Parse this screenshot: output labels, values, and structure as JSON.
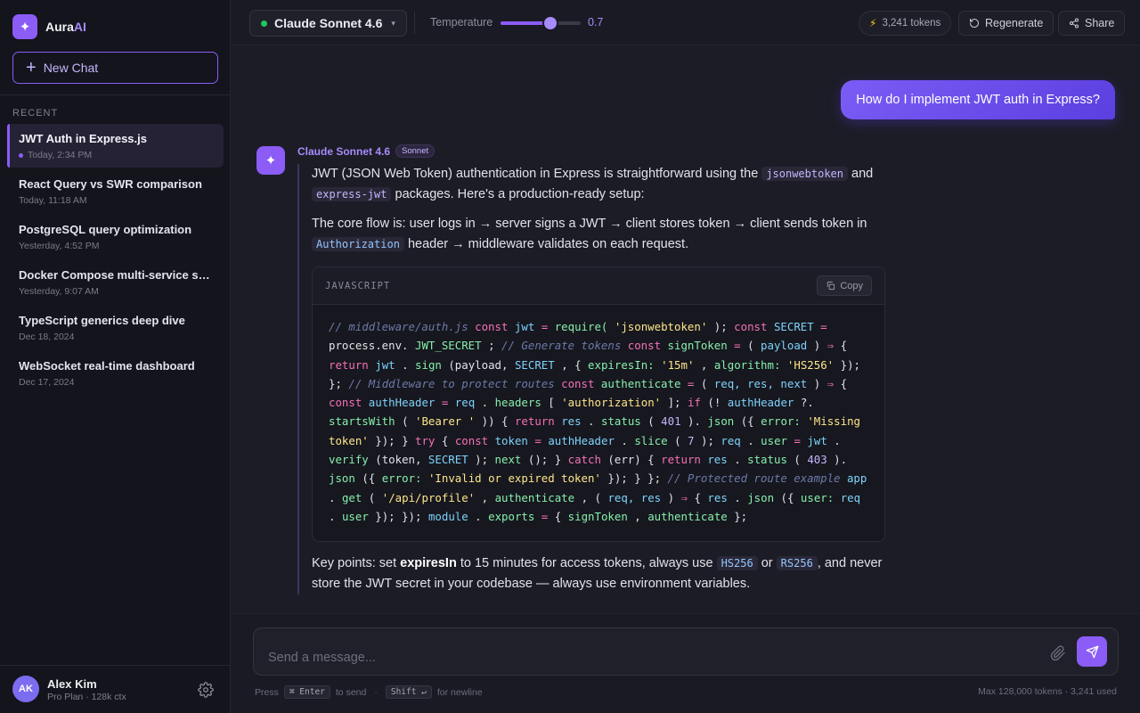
{
  "brand": {
    "name_main": "Aura",
    "name_accent": "AI",
    "logo_icon": "sparkle-icon"
  },
  "sidebar": {
    "new_chat_label": "New Chat",
    "recent_label": "RECENT",
    "items": [
      {
        "title": "JWT Auth in Express.js",
        "time": "Today, 2:34 PM",
        "active": true
      },
      {
        "title": "React Query vs SWR comparison",
        "time": "Today, 11:18 AM"
      },
      {
        "title": "PostgreSQL query optimization",
        "time": "Yesterday, 4:52 PM"
      },
      {
        "title": "Docker Compose multi-service set...",
        "time": "Yesterday, 9:07 AM"
      },
      {
        "title": "TypeScript generics deep dive",
        "time": "Dec 18, 2024"
      },
      {
        "title": "WebSocket real-time dashboard",
        "time": "Dec 17, 2024"
      }
    ],
    "user": {
      "initials": "AK",
      "name": "Alex Kim",
      "plan": "Pro Plan · 128k ctx"
    }
  },
  "topbar": {
    "model": "Claude Sonnet 4.6",
    "model_status_color": "#22c55e",
    "temperature_label": "Temperature",
    "temperature_value": "0.7",
    "temperature_fraction": 0.62,
    "tokens_label": "3,241 tokens",
    "regenerate_label": "Regenerate",
    "share_label": "Share"
  },
  "chat": {
    "user_message": "How do I implement JWT auth in Express?",
    "assistant": {
      "name": "Claude Sonnet 4.6",
      "badge": "Sonnet",
      "p1_a": "JWT (JSON Web Token) authentication in Express is straightforward using the",
      "p1_code1": "jsonwebtoken",
      "p1_b": "and",
      "p1_code2": "express-jwt",
      "p1_c": "packages. Here's a production-ready setup:",
      "p2_a": "The core flow is: user logs in → server signs a JWT → client stores token → client sends token in",
      "p2_code": "Authorization",
      "p2_b": "header → middleware validates on each request.",
      "code_lang": "JAVASCRIPT",
      "copy_label": "Copy",
      "p3_a": "Key points: set",
      "p3_bold": "expiresIn",
      "p3_b": "to 15 minutes for access tokens, always use",
      "p3_code1": "HS256",
      "p3_c": "or",
      "p3_code2": "RS256",
      "p3_d": ", and never store the JWT secret in your codebase — always use environment variables."
    }
  },
  "code_tokens": [
    [
      "com",
      "// middleware/auth.js"
    ],
    [
      "kw",
      "const"
    ],
    [
      "id",
      "jwt"
    ],
    [
      "op",
      "="
    ],
    [
      "fn",
      "require("
    ],
    [
      "str",
      "'jsonwebtoken'"
    ],
    [
      "pl",
      ");"
    ],
    [
      "kw",
      "const"
    ],
    [
      "id",
      "SECRET"
    ],
    [
      "op",
      "="
    ],
    [
      "pl",
      "process.env."
    ],
    [
      "fn",
      "JWT_SECRET"
    ],
    [
      "pl",
      ";"
    ],
    [
      "com",
      "// Generate tokens"
    ],
    [
      "kw",
      "const"
    ],
    [
      "fn",
      "signToken"
    ],
    [
      "op",
      "="
    ],
    [
      "pl",
      "("
    ],
    [
      "id",
      "payload"
    ],
    [
      "pl",
      ")"
    ],
    [
      "op",
      "⇒"
    ],
    [
      "pl",
      "{"
    ],
    [
      "kw",
      "return"
    ],
    [
      "id",
      "jwt"
    ],
    [
      "pl",
      "."
    ],
    [
      "fn",
      "sign"
    ],
    [
      "pl",
      "(payload,"
    ],
    [
      "id",
      "SECRET"
    ],
    [
      "pl",
      ", {"
    ],
    [
      "fn",
      "expiresIn:"
    ],
    [
      "str",
      "'15m'"
    ],
    [
      "pl",
      ","
    ],
    [
      "fn",
      "algorithm:"
    ],
    [
      "str",
      "'HS256'"
    ],
    [
      "pl",
      "}); };"
    ],
    [
      "com",
      "// Middleware to protect routes"
    ],
    [
      "kw",
      "const"
    ],
    [
      "fn",
      "authenticate"
    ],
    [
      "op",
      "="
    ],
    [
      "pl",
      "("
    ],
    [
      "id",
      "req,"
    ],
    [
      "id",
      "res,"
    ],
    [
      "id",
      "next"
    ],
    [
      "pl",
      ")"
    ],
    [
      "op",
      "⇒"
    ],
    [
      "pl",
      "{"
    ],
    [
      "kw",
      "const"
    ],
    [
      "id",
      "authHeader"
    ],
    [
      "op",
      "="
    ],
    [
      "id",
      "req"
    ],
    [
      "pl",
      "."
    ],
    [
      "fn",
      "headers"
    ],
    [
      "pl",
      "["
    ],
    [
      "str",
      "'authorization'"
    ],
    [
      "pl",
      "];"
    ],
    [
      "kw",
      "if"
    ],
    [
      "pl",
      "(!"
    ],
    [
      "id",
      "authHeader"
    ],
    [
      "pl",
      "?."
    ],
    [
      "fn",
      "startsWith"
    ],
    [
      "pl",
      "("
    ],
    [
      "str",
      "'Bearer"
    ],
    [
      "str",
      "'"
    ],
    [
      "pl",
      ")) {"
    ],
    [
      "kw",
      "return"
    ],
    [
      "id",
      "res"
    ],
    [
      "pl",
      "."
    ],
    [
      "fn",
      "status"
    ],
    [
      "pl",
      "("
    ],
    [
      "num",
      "401"
    ],
    [
      "pl",
      ")."
    ],
    [
      "fn",
      "json"
    ],
    [
      "pl",
      "({"
    ],
    [
      "fn",
      "error:"
    ],
    [
      "str",
      "'Missing token'"
    ],
    [
      "pl",
      "}); }"
    ],
    [
      "kw",
      "try"
    ],
    [
      "pl",
      "{"
    ],
    [
      "kw",
      "const"
    ],
    [
      "id",
      "token"
    ],
    [
      "op",
      "="
    ],
    [
      "id",
      "authHeader"
    ],
    [
      "pl",
      "."
    ],
    [
      "fn",
      "slice"
    ],
    [
      "pl",
      "("
    ],
    [
      "num",
      "7"
    ],
    [
      "pl",
      ");"
    ],
    [
      "id",
      "req"
    ],
    [
      "pl",
      "."
    ],
    [
      "fn",
      "user"
    ],
    [
      "op",
      "="
    ],
    [
      "id",
      "jwt"
    ],
    [
      "pl",
      "."
    ],
    [
      "fn",
      "verify"
    ],
    [
      "pl",
      "(token,"
    ],
    [
      "id",
      "SECRET"
    ],
    [
      "pl",
      ");"
    ],
    [
      "fn",
      "next"
    ],
    [
      "pl",
      "(); }"
    ],
    [
      "kw",
      "catch"
    ],
    [
      "pl",
      "(err) {"
    ],
    [
      "kw",
      "return"
    ],
    [
      "id",
      "res"
    ],
    [
      "pl",
      "."
    ],
    [
      "fn",
      "status"
    ],
    [
      "pl",
      "("
    ],
    [
      "num",
      "403"
    ],
    [
      "pl",
      ")."
    ],
    [
      "fn",
      "json"
    ],
    [
      "pl",
      "({"
    ],
    [
      "fn",
      "error:"
    ],
    [
      "str",
      "'Invalid or expired token'"
    ],
    [
      "pl",
      "}); } };"
    ],
    [
      "com",
      "// Protected route example"
    ],
    [
      "id",
      "app"
    ],
    [
      "pl",
      "."
    ],
    [
      "fn",
      "get"
    ],
    [
      "pl",
      "("
    ],
    [
      "str",
      "'/api/profile'"
    ],
    [
      "pl",
      ","
    ],
    [
      "fn",
      "authenticate"
    ],
    [
      "pl",
      ", ("
    ],
    [
      "id",
      "req,"
    ],
    [
      "id",
      "res"
    ],
    [
      "pl",
      ")"
    ],
    [
      "op",
      "⇒"
    ],
    [
      "pl",
      "{"
    ],
    [
      "id",
      "res"
    ],
    [
      "pl",
      "."
    ],
    [
      "fn",
      "json"
    ],
    [
      "pl",
      "({"
    ],
    [
      "fn",
      "user:"
    ],
    [
      "id",
      "req"
    ],
    [
      "pl",
      "."
    ],
    [
      "fn",
      "user"
    ],
    [
      "pl",
      "}); });"
    ],
    [
      "id",
      "module"
    ],
    [
      "pl",
      "."
    ],
    [
      "fn",
      "exports"
    ],
    [
      "op",
      "="
    ],
    [
      "pl",
      "{"
    ],
    [
      "fn",
      "signToken"
    ],
    [
      "pl",
      ","
    ],
    [
      "fn",
      "authenticate"
    ],
    [
      "pl",
      "};"
    ]
  ],
  "composer": {
    "placeholder": "Send a message...",
    "hint_press": "Press",
    "hint_enter_key": "⌘ Enter",
    "hint_to_send": "to send",
    "hint_shift_key": "Shift ↵",
    "hint_newline": "for newline",
    "token_info": "Max 128,000 tokens · 3,241 used"
  },
  "colors": {
    "accent": "#8b5cf6",
    "background": "#1a1a24",
    "sidebar": "#14141c"
  }
}
